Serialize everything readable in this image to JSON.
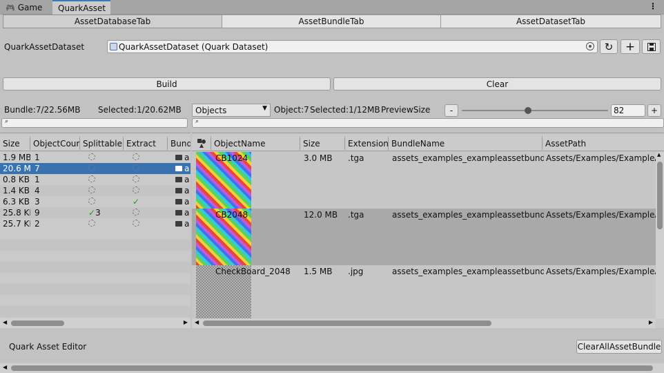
{
  "tabs": [
    {
      "icon": "gamepad-icon",
      "label": "Game"
    },
    {
      "label": "QuarkAsset"
    }
  ],
  "subtabs": [
    "AssetDatabaseTab",
    "AssetBundleTab",
    "AssetDatasetTab"
  ],
  "dataset": {
    "label": "QuarkAssetDataset",
    "value": "QuarkAssetDataset (Quark Dataset)"
  },
  "buttons": {
    "build": "Build",
    "clear": "Clear",
    "clear_all": "ClearAllAssetBundle"
  },
  "left_info": {
    "bundle": "Bundle:7/22.56MB",
    "selected": "Selected:1/20.62MB"
  },
  "right_info": {
    "filter_select": "Objects",
    "object": "Object:7",
    "selected": "Selected:1/12MB",
    "preview_label": "PreviewSize",
    "preview_value": "82",
    "minus": "-",
    "plus": "+"
  },
  "left_table": {
    "headers": [
      "Size",
      "ObjectCour",
      "Splittable",
      "Extract",
      "Bund"
    ],
    "rows": [
      {
        "size": "1.9 MB",
        "count": "1",
        "split": "",
        "split_count": "",
        "extract": "",
        "bundle": "a"
      },
      {
        "size": "20.6 M",
        "count": "7",
        "split": "",
        "split_count": "",
        "extract": "",
        "bundle": "a"
      },
      {
        "size": "0.8 KB",
        "count": "1",
        "split": "",
        "split_count": "",
        "extract": "",
        "bundle": "a"
      },
      {
        "size": "1.4 KB",
        "count": "4",
        "split": "",
        "split_count": "",
        "extract": "",
        "bundle": "a"
      },
      {
        "size": "6.3 KB",
        "count": "3",
        "split": "",
        "split_count": "",
        "extract": "✓",
        "bundle": "a"
      },
      {
        "size": "25.8 KE",
        "count": "9",
        "split": "✓",
        "split_count": "3",
        "extract": "",
        "bundle": "a"
      },
      {
        "size": "25.7 KE",
        "count": "2",
        "split": "",
        "split_count": "",
        "extract": "",
        "bundle": "a"
      }
    ]
  },
  "right_table": {
    "headers": [
      "ObjectName",
      "Size",
      "Extension",
      "BundleName",
      "AssetPath"
    ],
    "rows": [
      {
        "name": "CB1024",
        "size": "3.0 MB",
        "ext": ".tga",
        "bundle": "assets_examples_exampleassetbundle",
        "path": "Assets/Examples/ExampleAs"
      },
      {
        "name": "CB2048",
        "size": "12.0 MB",
        "ext": ".tga",
        "bundle": "assets_examples_exampleassetbundle",
        "path": "Assets/Examples/ExampleAs"
      },
      {
        "name": "CheckBoard_2048",
        "size": "1.5 MB",
        "ext": ".jpg",
        "bundle": "assets_examples_exampleassetbundle",
        "path": "Assets/Examples/ExampleAs"
      }
    ]
  },
  "footer": {
    "title": "Quark Asset Editor"
  },
  "colors": {
    "selection": "#3a72b0",
    "header_bg": "#cbcbcb",
    "tab_accent": "#3a79bb"
  }
}
